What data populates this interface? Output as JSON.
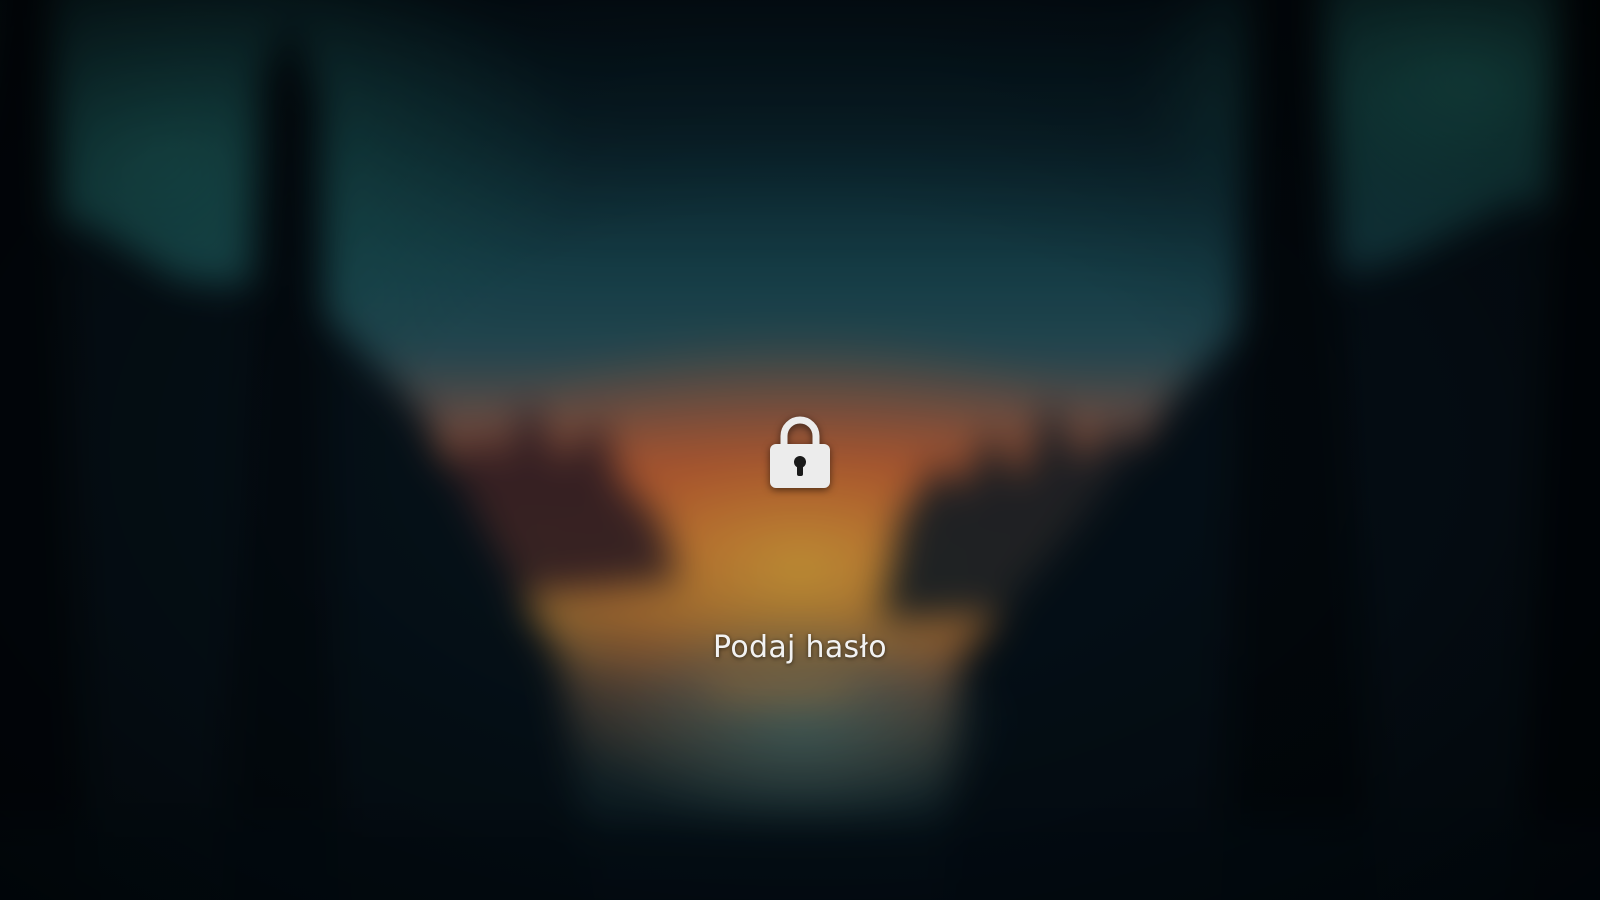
{
  "lock_screen": {
    "prompt_text": "Podaj hasło",
    "icon": "lock-icon",
    "wallpaper": "blurred-forest-sunset"
  },
  "colors": {
    "prompt_text": "#f2f2f2",
    "lock_icon": "#ececec",
    "sky_top": "#03101a",
    "sky_teal": "#1f5560",
    "sunset_orange": "#d86a35",
    "sunset_yellow": "#d8a53a",
    "forest_dark": "#05111a"
  }
}
